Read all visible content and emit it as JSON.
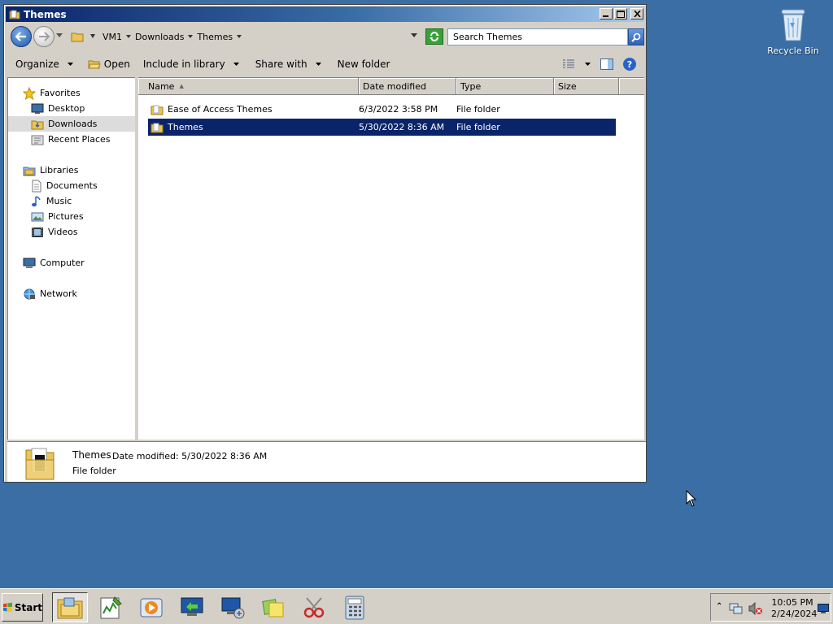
{
  "desktop": {
    "recycle_bin_label": "Recycle Bin"
  },
  "window": {
    "title": "Themes",
    "controls": {
      "minimize": "minimize",
      "maximize": "maximize",
      "close": "close"
    }
  },
  "address": {
    "breadcrumbs": [
      "VM1",
      "Downloads",
      "Themes"
    ],
    "search_placeholder": "Search Themes"
  },
  "toolbar": {
    "organize": "Organize",
    "open": "Open",
    "include_in_library": "Include in library",
    "share_with": "Share with",
    "new_folder": "New folder"
  },
  "nav": {
    "favorites": "Favorites",
    "desktop": "Desktop",
    "downloads": "Downloads",
    "recent_places": "Recent Places",
    "libraries": "Libraries",
    "documents": "Documents",
    "music": "Music",
    "pictures": "Pictures",
    "videos": "Videos",
    "computer": "Computer",
    "network": "Network",
    "selected": "Downloads"
  },
  "columns": {
    "name": "Name",
    "date_modified": "Date modified",
    "type": "Type",
    "size": "Size"
  },
  "files": [
    {
      "name": "Ease of Access Themes",
      "date": "6/3/2022 3:58 PM",
      "type": "File folder",
      "selected": false
    },
    {
      "name": "Themes",
      "date": "5/30/2022 8:36 AM",
      "type": "File folder",
      "selected": true
    }
  ],
  "details": {
    "name": "Themes",
    "meta": "Date modified: 5/30/2022 8:36 AM",
    "type": "File folder"
  },
  "taskbar": {
    "start": "Start",
    "apps": [
      "file-explorer",
      "notepad-plus",
      "media-player",
      "remote-desktop",
      "network-connect",
      "sticky-notes",
      "snipping-tool",
      "calculator"
    ],
    "time": "10:05 PM",
    "date": "2/24/2024"
  },
  "colors": {
    "desktop_bg": "#3a6ea5",
    "selection": "#0a246a",
    "window_face": "#d4d0c8"
  }
}
